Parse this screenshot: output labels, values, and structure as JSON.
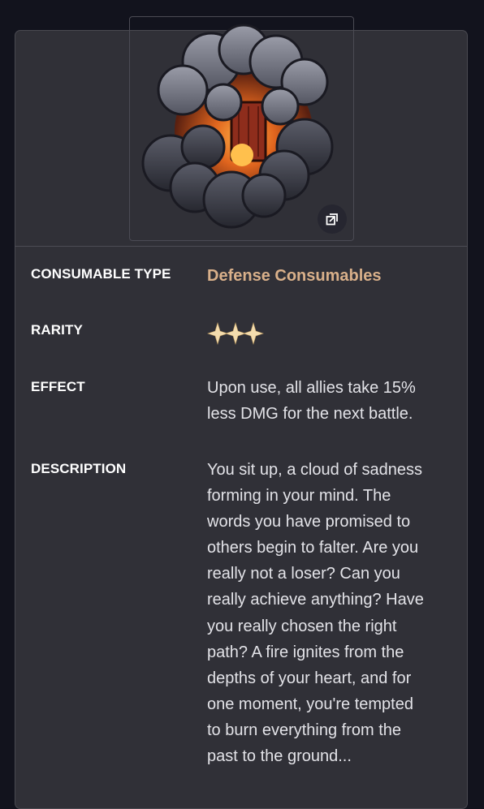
{
  "item": {
    "image_alt": "Dark smoke cloud with burning door",
    "rarity_stars": 3,
    "star_color": "#f2d8a6",
    "accent_color": "#d9b08a"
  },
  "attributes": {
    "consumable_type": {
      "label": "CONSUMABLE TYPE",
      "value": "Defense Consumables"
    },
    "rarity": {
      "label": "RARITY"
    },
    "effect": {
      "label": "EFFECT",
      "lines": [
        "Upon use, all allies take 15%",
        "less DMG for the next battle."
      ]
    },
    "description": {
      "label": "DESCRIPTION",
      "lines": [
        "You sit up, a cloud of sadness",
        "forming in your mind. The",
        "words you have promised to",
        "others begin to falter. Are you",
        "really not a loser? Can you",
        "really achieve anything? Have",
        "you really chosen the right",
        "path? A fire ignites from the",
        "depths of your heart, and for",
        "one moment, you're tempted",
        "to burn everything from the",
        "past to the ground..."
      ]
    }
  },
  "icons": {
    "expand": "expand-icon",
    "star": "star-icon"
  }
}
